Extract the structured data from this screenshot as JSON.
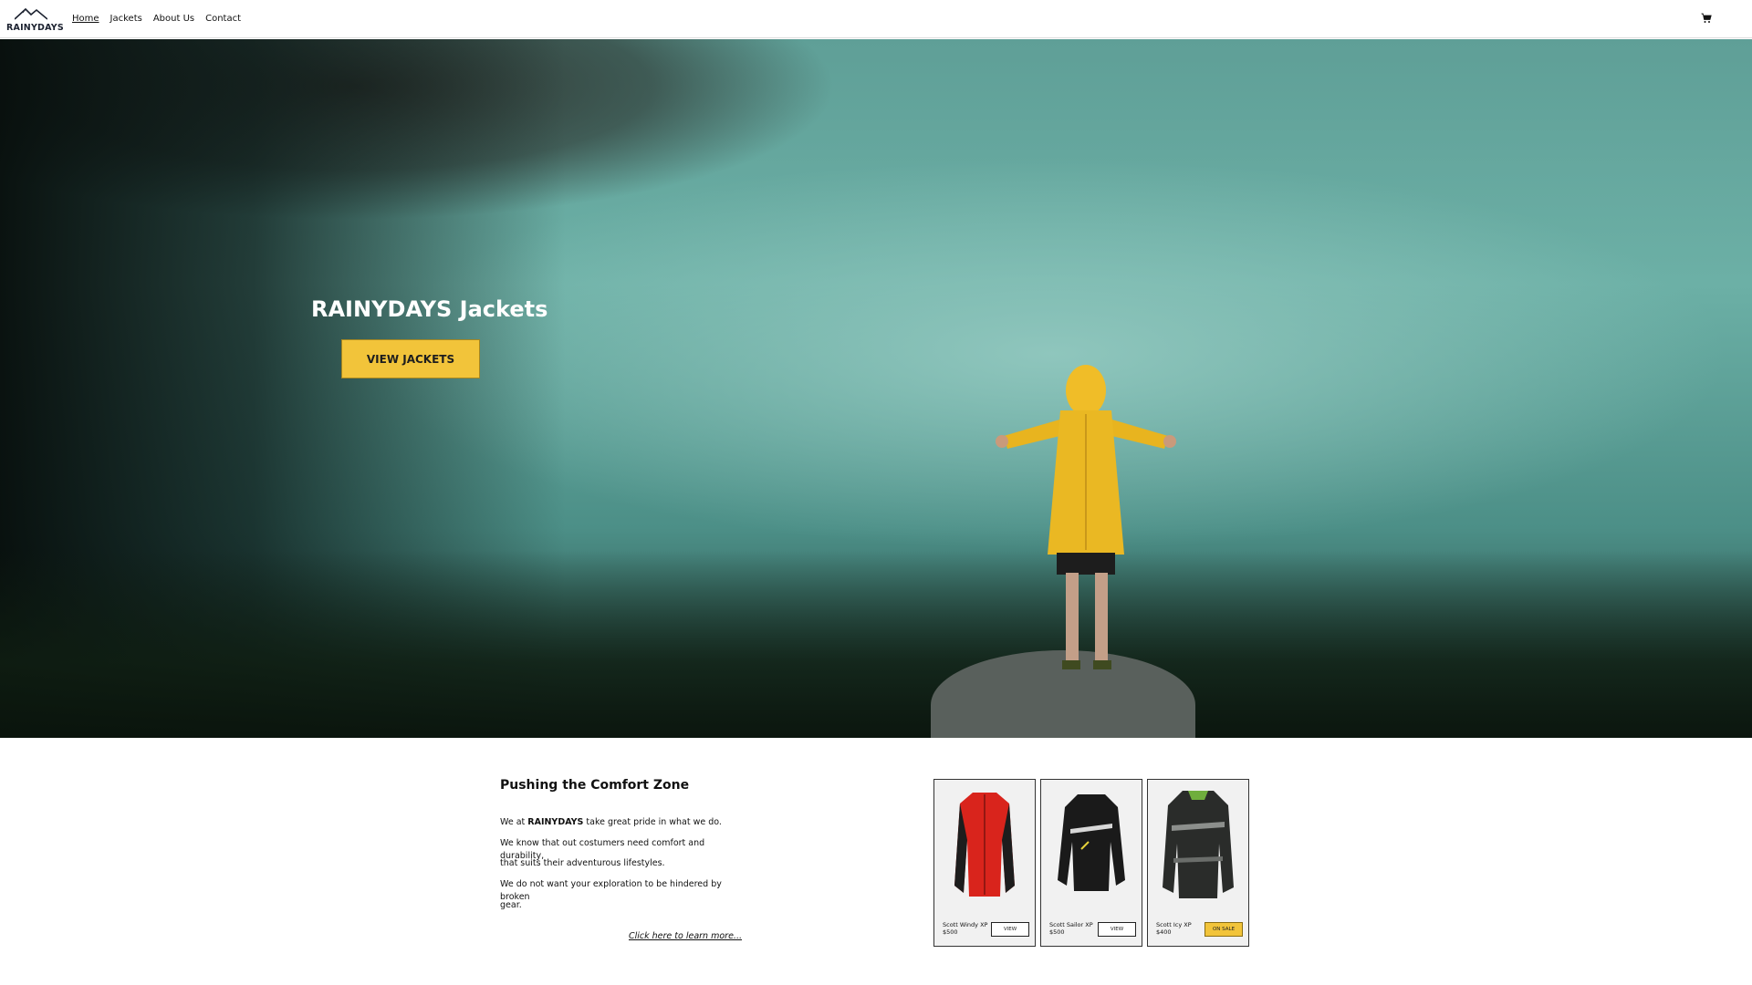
{
  "header": {
    "logo_text": "RAINYDAYS",
    "nav": [
      {
        "label": "Home",
        "active": true
      },
      {
        "label": "Jackets",
        "active": false
      },
      {
        "label": "About Us",
        "active": false
      },
      {
        "label": "Contact",
        "active": false
      }
    ],
    "cart_icon": "cart-icon"
  },
  "hero": {
    "title": "RAINYDAYS Jackets",
    "button_label": "VIEW JACKETS",
    "button_color": "#f2c43a"
  },
  "info": {
    "heading": "Pushing the Comfort Zone",
    "line1_prefix": "We at ",
    "line1_brand": "RAINYDAYS",
    "line1_suffix": " take great pride in what we do.",
    "line2": "We know that out costumers need comfort and durability,",
    "line3": "that suits their adventurous lifestyles.",
    "line4": "We do not want your exploration to be hindered by broken",
    "line5": "gear.",
    "link": "Click here to learn more..."
  },
  "products": [
    {
      "name": "Scott Windy XP",
      "price": "$500",
      "button": "VIEW",
      "jacket_color": "#d9241c"
    },
    {
      "name": "Scott Sailor XP",
      "price": "$500",
      "button": "VIEW",
      "jacket_color": "#1a1a1a"
    },
    {
      "name": "Scott Icy XP",
      "price": "$400",
      "button": "ON SALE",
      "jacket_color": "#2a2c2a"
    }
  ]
}
